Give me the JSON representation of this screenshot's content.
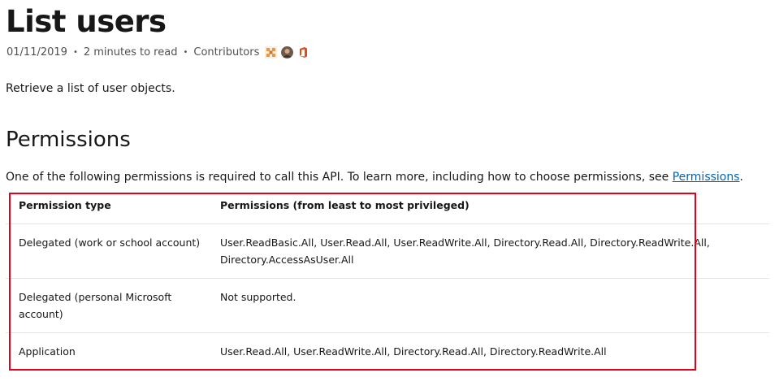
{
  "page": {
    "title": "List users",
    "meta": {
      "date": "01/11/2019",
      "read_time": "2 minutes to read",
      "contributors_label": "Contributors",
      "contributor_avatars": [
        "pinwheel-avatar",
        "photo-avatar",
        "office-avatar"
      ]
    },
    "intro": "Retrieve a list of user objects.",
    "permissions_heading": "Permissions",
    "permissions_lead": "One of the following permissions is required to call this API. To learn more, including how to choose permissions, see ",
    "permissions_link": "Permissions",
    "permissions_lead_end": "."
  },
  "table": {
    "headers": [
      "Permission type",
      "Permissions (from least to most privileged)"
    ],
    "rows": [
      {
        "type": "Delegated (work or school account)",
        "perms": "User.ReadBasic.All, User.Read.All, User.ReadWrite.All, Directory.Read.All, Directory.ReadWrite.All, Directory.AccessAsUser.All"
      },
      {
        "type": "Delegated (personal Microsoft account)",
        "perms": "Not supported."
      },
      {
        "type": "Application",
        "perms": "User.Read.All, User.ReadWrite.All, Directory.Read.All, Directory.ReadWrite.All"
      }
    ]
  },
  "colors": {
    "link": "#0065b3",
    "highlight_border": "#e2001a",
    "office_icon": "#e64a19"
  }
}
